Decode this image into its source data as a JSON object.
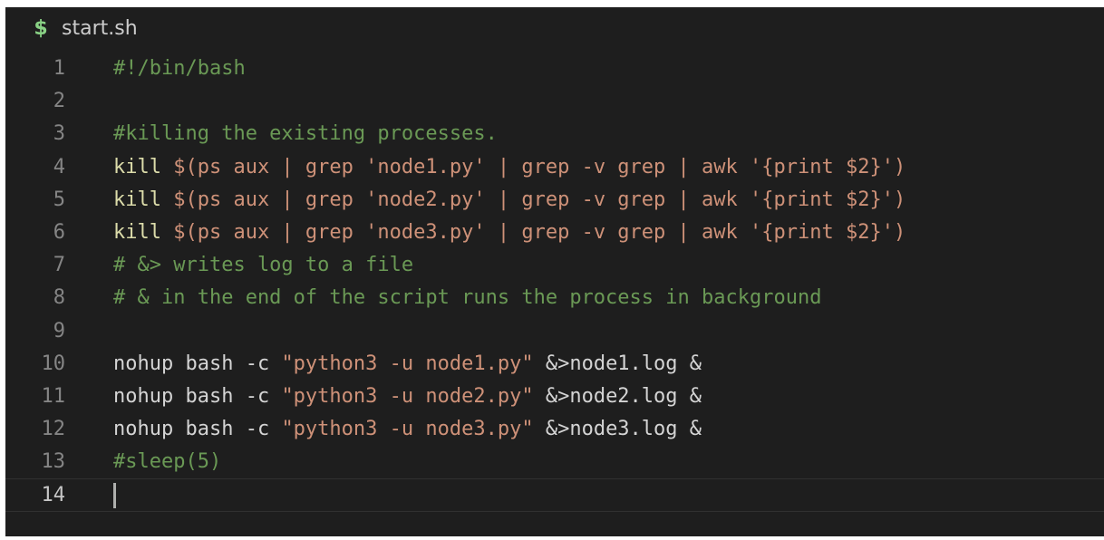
{
  "tab": {
    "icon": "dollar-shell-icon",
    "title": "start.sh"
  },
  "colors": {
    "background": "#1e1e1e",
    "comment": "#6a9955",
    "builtin": "#dcdcaa",
    "string": "#ce9178",
    "plain": "#d4d4d4",
    "line_number": "#858585"
  },
  "lines": [
    {
      "num": "1",
      "tokens": [
        {
          "t": "#!/bin/bash",
          "c": "comment"
        }
      ]
    },
    {
      "num": "2",
      "tokens": []
    },
    {
      "num": "3",
      "tokens": [
        {
          "t": "#killing the existing processes.",
          "c": "comment"
        }
      ]
    },
    {
      "num": "4",
      "tokens": [
        {
          "t": "kill",
          "c": "builtin"
        },
        {
          "t": " $(ps aux | grep ",
          "c": "string"
        },
        {
          "t": "'node1.py'",
          "c": "string"
        },
        {
          "t": " | grep -v grep | awk ",
          "c": "string"
        },
        {
          "t": "'{print $2}'",
          "c": "string"
        },
        {
          "t": ")",
          "c": "string"
        }
      ]
    },
    {
      "num": "5",
      "tokens": [
        {
          "t": "kill",
          "c": "builtin"
        },
        {
          "t": " $(ps aux | grep ",
          "c": "string"
        },
        {
          "t": "'node2.py'",
          "c": "string"
        },
        {
          "t": " | grep -v grep | awk ",
          "c": "string"
        },
        {
          "t": "'{print $2}'",
          "c": "string"
        },
        {
          "t": ")",
          "c": "string"
        }
      ]
    },
    {
      "num": "6",
      "tokens": [
        {
          "t": "kill",
          "c": "builtin"
        },
        {
          "t": " $(ps aux | grep ",
          "c": "string"
        },
        {
          "t": "'node3.py'",
          "c": "string"
        },
        {
          "t": " | grep -v grep | awk ",
          "c": "string"
        },
        {
          "t": "'{print $2}'",
          "c": "string"
        },
        {
          "t": ")",
          "c": "string"
        }
      ]
    },
    {
      "num": "7",
      "tokens": [
        {
          "t": "# &> writes log to a file",
          "c": "comment"
        }
      ]
    },
    {
      "num": "8",
      "tokens": [
        {
          "t": "# & in the end of the script runs the process in background",
          "c": "comment"
        }
      ]
    },
    {
      "num": "9",
      "tokens": []
    },
    {
      "num": "10",
      "tokens": [
        {
          "t": "nohup bash -c ",
          "c": "plain"
        },
        {
          "t": "\"python3 -u node1.py\"",
          "c": "string"
        },
        {
          "t": " &>node1.log &",
          "c": "plain"
        }
      ]
    },
    {
      "num": "11",
      "tokens": [
        {
          "t": "nohup bash -c ",
          "c": "plain"
        },
        {
          "t": "\"python3 -u node2.py\"",
          "c": "string"
        },
        {
          "t": " &>node2.log &",
          "c": "plain"
        }
      ]
    },
    {
      "num": "12",
      "tokens": [
        {
          "t": "nohup bash -c ",
          "c": "plain"
        },
        {
          "t": "\"python3 -u node3.py\"",
          "c": "string"
        },
        {
          "t": " &>node3.log &",
          "c": "plain"
        }
      ]
    },
    {
      "num": "13",
      "tokens": [
        {
          "t": "#sleep(5)",
          "c": "comment"
        }
      ]
    },
    {
      "num": "14",
      "tokens": [],
      "current": true
    }
  ]
}
